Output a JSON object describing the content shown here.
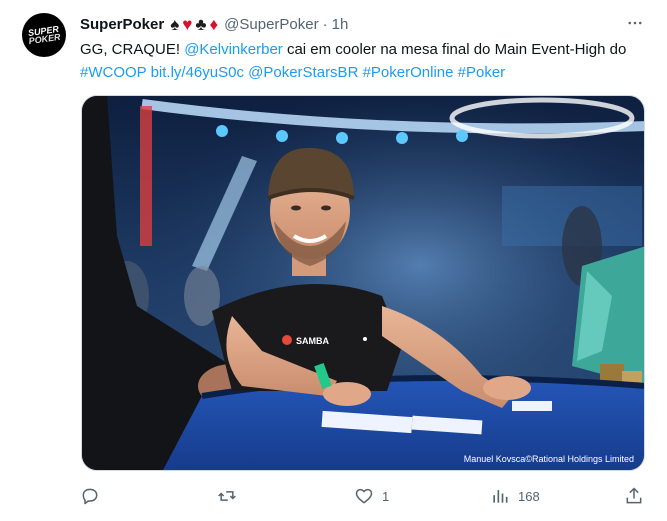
{
  "tweet": {
    "display_name": "SuperPoker",
    "suits": [
      "♠",
      "♥",
      "♣",
      "♦"
    ],
    "handle": "@SuperPoker",
    "separator": "·",
    "time": "1h",
    "avatar_text_1": "SUPER",
    "avatar_text_2": "POKER",
    "text_parts": {
      "p1": "GG, CRAQUE! ",
      "mention": "@Kelvinkerber",
      "p2": " cai em cooler na mesa final do Main Event-High do ",
      "hashtag1": "#WCOOP",
      "space1": " ",
      "url": "bit.ly/46yuS0c",
      "space2": " ",
      "mention2": "@PokerStarsBR",
      "space3": " ",
      "hashtag2": "#PokerOnline",
      "space4": " ",
      "hashtag3": "#Poker"
    },
    "photo_credit": "Manuel Kovsca©Rational Holdings Limited",
    "shirt_logo": "SAMBA"
  },
  "actions": {
    "reply_count": "",
    "retweet_count": "",
    "like_count": "1",
    "views_count": "168"
  },
  "icons": {
    "more": "more-icon",
    "reply": "reply-icon",
    "retweet": "retweet-icon",
    "like": "heart-icon",
    "views": "views-icon",
    "share": "share-icon"
  },
  "colors": {
    "link": "#1d9bf0",
    "muted": "#536471",
    "text": "#0f1419",
    "red_suit": "#d3142d"
  }
}
